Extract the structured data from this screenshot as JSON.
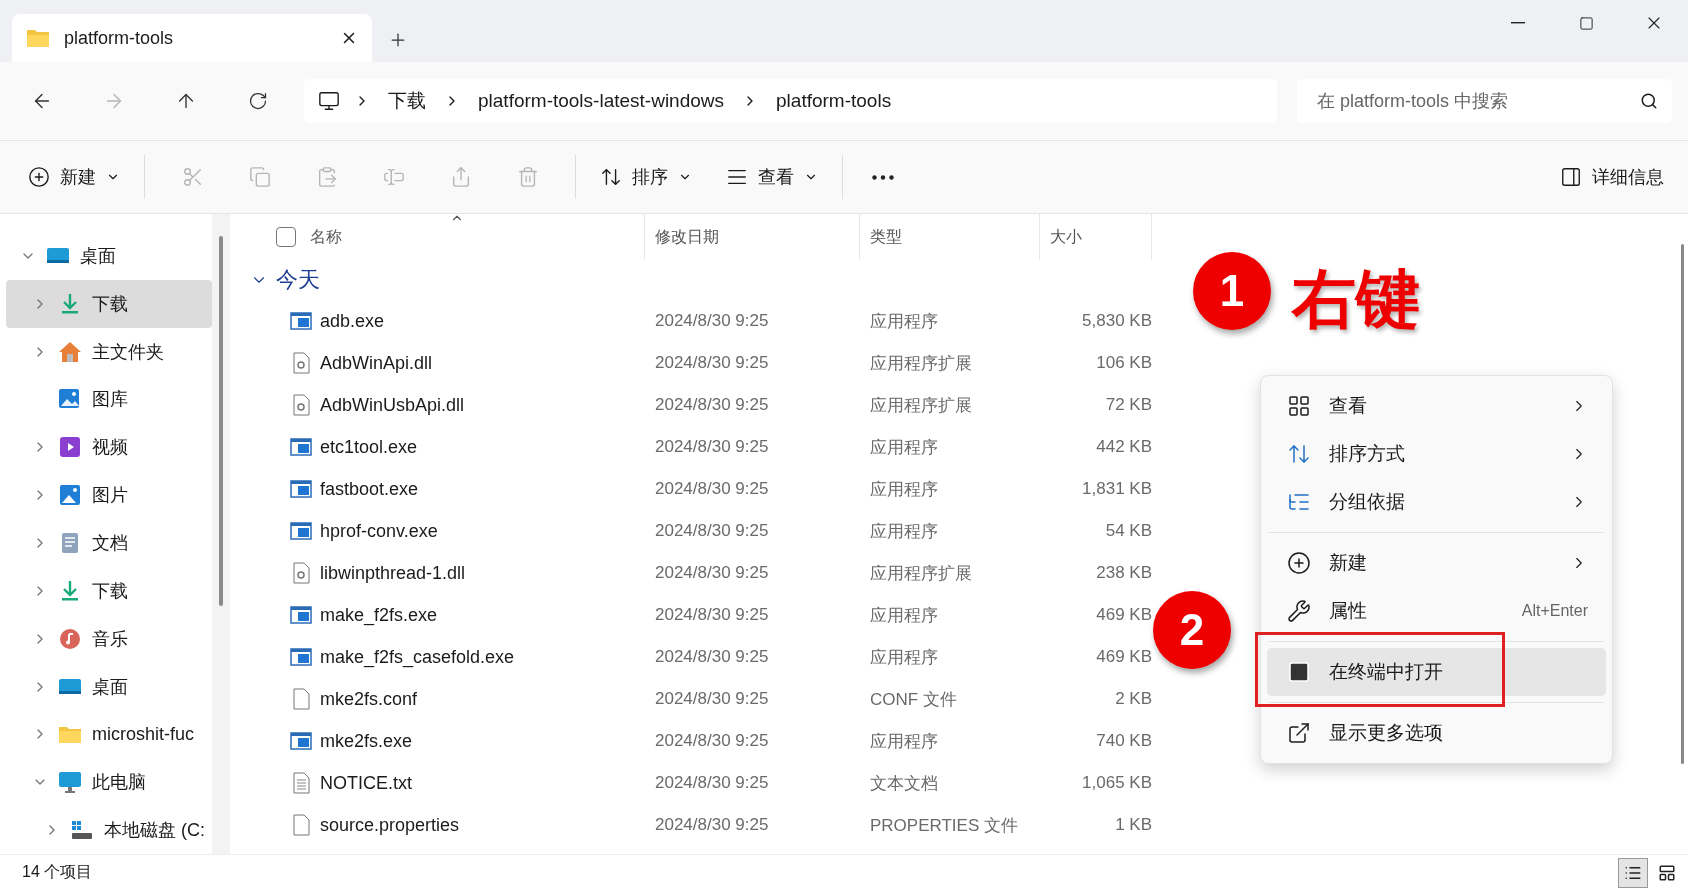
{
  "tabs": [
    {
      "title": "platform-tools",
      "selected": true
    }
  ],
  "address": {
    "crumbs": [
      "下载",
      "platform-tools-latest-windows",
      "platform-tools"
    ],
    "search_placeholder": "在 platform-tools 中搜索"
  },
  "toolbar": {
    "new_label": "新建",
    "actions": [
      {
        "kind": "cut",
        "disabled": true
      },
      {
        "kind": "copy",
        "disabled": true
      },
      {
        "kind": "paste",
        "disabled": true
      },
      {
        "kind": "rename",
        "disabled": true
      },
      {
        "kind": "share",
        "disabled": true
      },
      {
        "kind": "delete",
        "disabled": true
      }
    ],
    "sort_label": "排序",
    "view_label": "查看",
    "details_label": "详细信息"
  },
  "sidebar": {
    "items": [
      {
        "label": "桌面",
        "kind": "desktop",
        "expanded": true,
        "selected": false,
        "children": [
          {
            "label": "下载",
            "kind": "download",
            "expanded": false,
            "selected": true
          },
          {
            "label": "主文件夹",
            "kind": "home",
            "expanded": false,
            "selected": false
          },
          {
            "label": "图库",
            "kind": "gallery",
            "selected": false
          },
          {
            "label": "视频",
            "kind": "video",
            "expanded": false,
            "selected": false
          },
          {
            "label": "图片",
            "kind": "pictures",
            "expanded": false,
            "selected": false
          },
          {
            "label": "文档",
            "kind": "documents",
            "expanded": false,
            "selected": false
          },
          {
            "label": "下载",
            "kind": "download",
            "expanded": false,
            "selected": false
          },
          {
            "label": "音乐",
            "kind": "music",
            "expanded": false,
            "selected": false
          },
          {
            "label": "桌面",
            "kind": "desktop",
            "expanded": false,
            "selected": false
          },
          {
            "label": "microshit-fuc",
            "kind": "folder",
            "expanded": false,
            "selected": false
          },
          {
            "label": "此电脑",
            "kind": "pc",
            "expanded": true,
            "selected": false,
            "children": [
              {
                "label": "本地磁盘 (C:",
                "kind": "drive",
                "expanded": false,
                "selected": false
              }
            ]
          }
        ]
      }
    ]
  },
  "table": {
    "select_all_checked": false,
    "columns": [
      "名称",
      "修改日期",
      "类型",
      "大小"
    ],
    "group": {
      "label": "今天",
      "expanded": true
    },
    "rows": [
      {
        "name": "adb.exe",
        "date": "2024/8/30 9:25",
        "type": "应用程序",
        "size": "5,830 KB",
        "kind": "exe"
      },
      {
        "name": "AdbWinApi.dll",
        "date": "2024/8/30 9:25",
        "type": "应用程序扩展",
        "size": "106 KB",
        "kind": "dll"
      },
      {
        "name": "AdbWinUsbApi.dll",
        "date": "2024/8/30 9:25",
        "type": "应用程序扩展",
        "size": "72 KB",
        "kind": "dll"
      },
      {
        "name": "etc1tool.exe",
        "date": "2024/8/30 9:25",
        "type": "应用程序",
        "size": "442 KB",
        "kind": "exe"
      },
      {
        "name": "fastboot.exe",
        "date": "2024/8/30 9:25",
        "type": "应用程序",
        "size": "1,831 KB",
        "kind": "exe"
      },
      {
        "name": "hprof-conv.exe",
        "date": "2024/8/30 9:25",
        "type": "应用程序",
        "size": "54 KB",
        "kind": "exe"
      },
      {
        "name": "libwinpthread-1.dll",
        "date": "2024/8/30 9:25",
        "type": "应用程序扩展",
        "size": "238 KB",
        "kind": "dll"
      },
      {
        "name": "make_f2fs.exe",
        "date": "2024/8/30 9:25",
        "type": "应用程序",
        "size": "469 KB",
        "kind": "exe"
      },
      {
        "name": "make_f2fs_casefold.exe",
        "date": "2024/8/30 9:25",
        "type": "应用程序",
        "size": "469 KB",
        "kind": "exe"
      },
      {
        "name": "mke2fs.conf",
        "date": "2024/8/30 9:25",
        "type": "CONF 文件",
        "size": "2 KB",
        "kind": "file"
      },
      {
        "name": "mke2fs.exe",
        "date": "2024/8/30 9:25",
        "type": "应用程序",
        "size": "740 KB",
        "kind": "exe"
      },
      {
        "name": "NOTICE.txt",
        "date": "2024/8/30 9:25",
        "type": "文本文档",
        "size": "1,065 KB",
        "kind": "text"
      },
      {
        "name": "source.properties",
        "date": "2024/8/30 9:25",
        "type": "PROPERTIES 文件",
        "size": "1 KB",
        "kind": "file"
      }
    ]
  },
  "context_menu": {
    "sections": [
      {
        "items": [
          {
            "label": "查看",
            "kind": "view",
            "submenu": true,
            "selected": false
          },
          {
            "label": "排序方式",
            "kind": "sort",
            "submenu": true,
            "selected": false
          },
          {
            "label": "分组依据",
            "kind": "group",
            "submenu": true,
            "selected": false
          }
        ]
      },
      {
        "items": [
          {
            "label": "新建",
            "kind": "new",
            "submenu": true,
            "selected": false
          },
          {
            "label": "属性",
            "kind": "properties",
            "submenu": false,
            "shortcut": "Alt+Enter",
            "selected": false
          }
        ]
      },
      {
        "items": [
          {
            "label": "在终端中打开",
            "kind": "terminal",
            "submenu": false,
            "selected": true
          }
        ]
      },
      {
        "items": [
          {
            "label": "显示更多选项",
            "kind": "more",
            "submenu": false,
            "selected": false
          }
        ]
      }
    ]
  },
  "annotations": [
    {
      "number": "1",
      "label": "右键"
    },
    {
      "number": "2"
    }
  ],
  "status_bar": {
    "count": "14 个项目",
    "views": [
      {
        "kind": "details",
        "selected": true
      },
      {
        "kind": "tiles",
        "selected": false
      }
    ]
  }
}
